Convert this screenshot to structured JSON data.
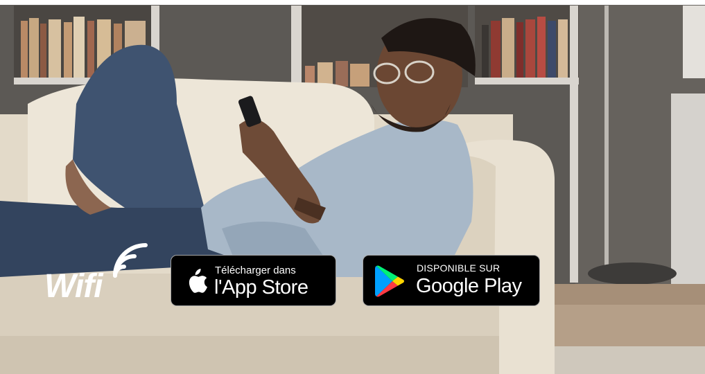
{
  "hero": {
    "image_subject": "man-with-phone-on-sofa-photo",
    "colors": {
      "wall": "#5f5c58",
      "sofa": "#e7dfd0",
      "jeans": "#3f5370",
      "shirt": "#a9b8c7",
      "floor": "#a68f78"
    }
  },
  "logo": {
    "text": "Wifi",
    "icon": "wifi-signal-icon"
  },
  "badges": {
    "app_store": {
      "small_text": "Télécharger dans",
      "big_text": "l'App Store",
      "icon": "apple-icon"
    },
    "google_play": {
      "small_text": "DISPONIBLE SUR",
      "big_text": "Google Play",
      "icon": "google-play-icon"
    }
  }
}
